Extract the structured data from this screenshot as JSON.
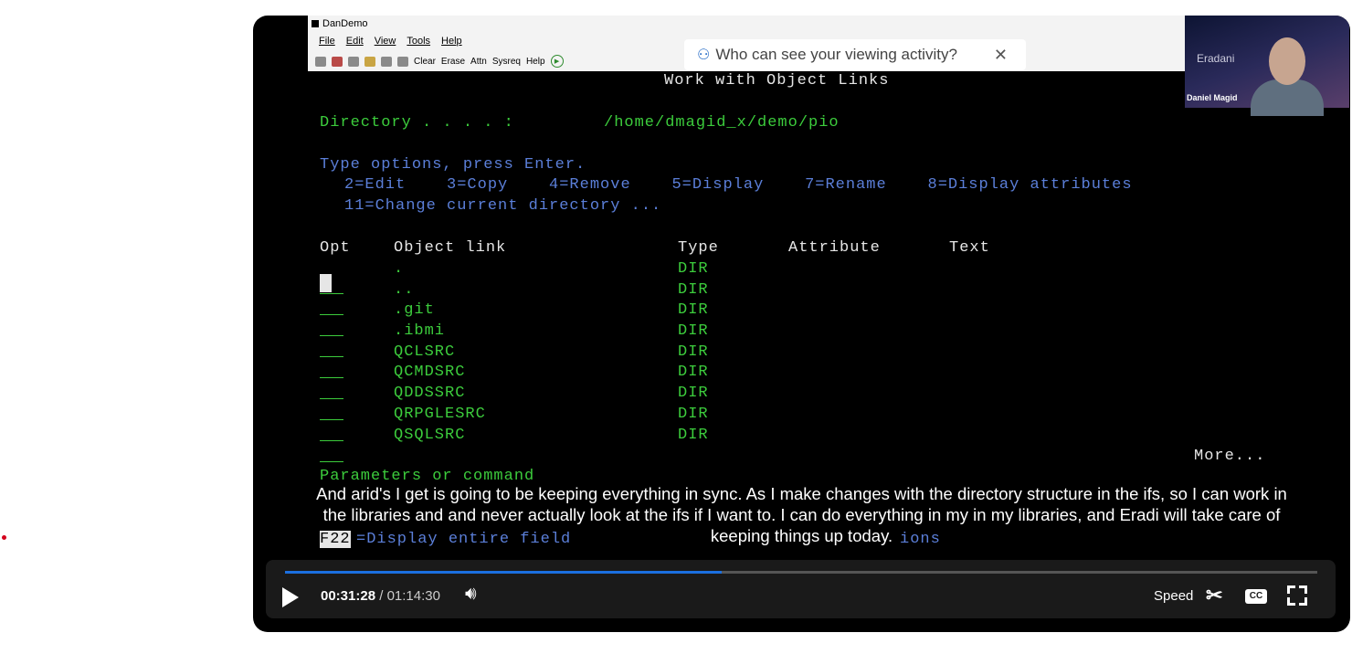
{
  "emulator": {
    "window_title": "DanDemo",
    "menu": [
      "File",
      "Edit",
      "View",
      "Tools",
      "Help"
    ],
    "toolbar": [
      "Clear",
      "Erase",
      "Attn",
      "Sysreq",
      "Help"
    ]
  },
  "terminal": {
    "title": "Work with Object Links",
    "directory_label": "Directory . . . . :",
    "directory_value": "/home/dmagid_x/demo/pio",
    "instructions": "Type options, press Enter.",
    "options_line1": "2=Edit    3=Copy    4=Remove    5=Display    7=Rename    8=Display attributes",
    "options_line2": "11=Change current directory ...",
    "headers": {
      "opt": "Opt",
      "object": "Object link",
      "type": "Type",
      "attribute": "Attribute",
      "text": "Text"
    },
    "rows": [
      {
        "name": ".",
        "type": "DIR"
      },
      {
        "name": "..",
        "type": "DIR"
      },
      {
        "name": ".git",
        "type": "DIR"
      },
      {
        "name": ".ibmi",
        "type": "DIR"
      },
      {
        "name": "QCLSRC",
        "type": "DIR"
      },
      {
        "name": "QCMDSRC",
        "type": "DIR"
      },
      {
        "name": "QDDSSRC",
        "type": "DIR"
      },
      {
        "name": "QRPGLESRC",
        "type": "DIR"
      },
      {
        "name": "QSQLSRC",
        "type": "DIR"
      }
    ],
    "more": "More...",
    "parameters": "Parameters or command",
    "f22": "F22",
    "f22_text": "=Display entire field",
    "partial_options": "ions"
  },
  "privacy_banner": {
    "text": "Who can see your viewing activity?"
  },
  "webcam": {
    "brand": "Eradani",
    "name": "Daniel Magid"
  },
  "captions": {
    "line1": "And arid's I get is going to be keeping everything in sync. As I make changes with the directory structure in the ifs, so I can work in",
    "line2": "the libraries and and never actually look at the ifs if I want to. I can do everything in my in my libraries, and Eradi will take care of",
    "line3": "keeping things up today."
  },
  "player": {
    "current_time": "00:31:28",
    "separator": "/",
    "total_time": "01:14:30",
    "speed_label": "Speed",
    "cc_label": "CC",
    "progress": 0.423
  }
}
